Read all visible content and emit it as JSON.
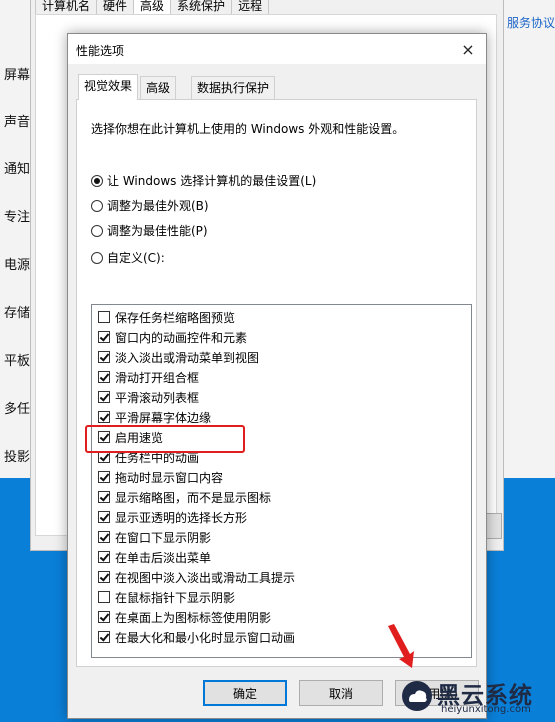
{
  "background": {
    "sidebar_labels": [
      "屏幕",
      "声音",
      "通知",
      "专注",
      "电源",
      "存储",
      "平板",
      "多任",
      "投影"
    ],
    "link": "服务协议",
    "sys_tabs": [
      "计算机名",
      "硬件",
      "高级",
      "系统保护",
      "远程"
    ]
  },
  "dialog": {
    "title": "性能选项",
    "close": "×",
    "tabs": [
      "视觉效果",
      "高级",
      "数据执行保护"
    ],
    "description": "选择你想在此计算机上使用的 Windows 外观和性能设置。",
    "radios": [
      {
        "label": "让 Windows 选择计算机的最佳设置(L)",
        "selected": true
      },
      {
        "label": "调整为最佳外观(B)",
        "selected": false
      },
      {
        "label": "调整为最佳性能(P)",
        "selected": false
      },
      {
        "label": "自定义(C):",
        "selected": false
      }
    ],
    "options": [
      {
        "label": "保存任务栏缩略图预览",
        "checked": false
      },
      {
        "label": "窗口内的动画控件和元素",
        "checked": true
      },
      {
        "label": "淡入淡出或滑动菜单到视图",
        "checked": true
      },
      {
        "label": "滑动打开组合框",
        "checked": true
      },
      {
        "label": "平滑滚动列表框",
        "checked": true
      },
      {
        "label": "平滑屏幕字体边缘",
        "checked": true
      },
      {
        "label": "启用速览",
        "checked": true
      },
      {
        "label": "任务栏中的动画",
        "checked": true
      },
      {
        "label": "拖动时显示窗口内容",
        "checked": true
      },
      {
        "label": "显示缩略图，而不是显示图标",
        "checked": true
      },
      {
        "label": "显示亚透明的选择长方形",
        "checked": true
      },
      {
        "label": "在窗口下显示阴影",
        "checked": true
      },
      {
        "label": "在单击后淡出菜单",
        "checked": true
      },
      {
        "label": "在视图中淡入淡出或滑动工具提示",
        "checked": true
      },
      {
        "label": "在鼠标指针下显示阴影",
        "checked": false
      },
      {
        "label": "在桌面上为图标标签使用阴影",
        "checked": true
      },
      {
        "label": "在最大化和最小化时显示窗口动画",
        "checked": true
      }
    ],
    "buttons": {
      "ok": "确定",
      "cancel": "取消",
      "apply": "应用(A)"
    }
  },
  "watermark": {
    "title": "黑云系统",
    "url": "heiyunxitong.com"
  },
  "colors": {
    "highlight": "#e01e1e",
    "accent": "#0078d7",
    "desktop": "#0a7fd8"
  }
}
